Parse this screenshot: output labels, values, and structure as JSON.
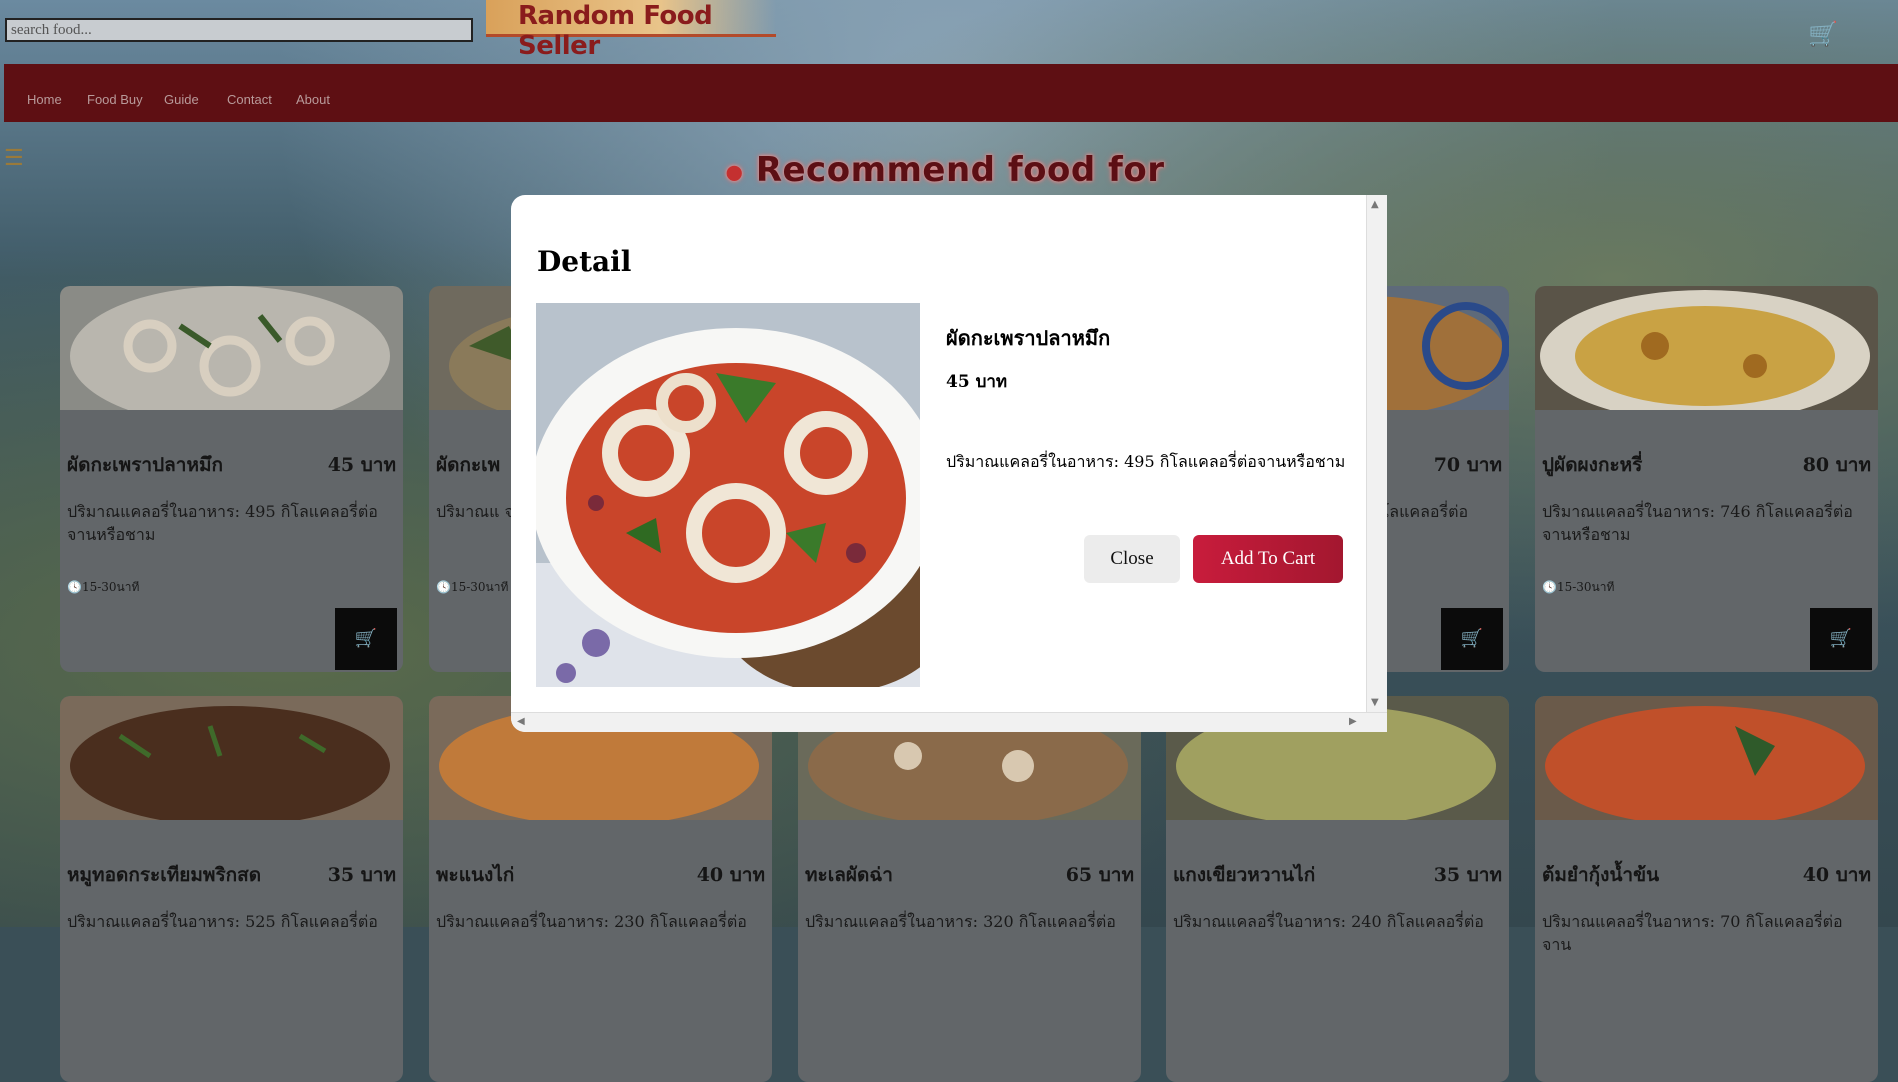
{
  "header": {
    "search_placeholder": "search food...",
    "logo_text": "Random Food Seller",
    "cart_icon": "shopping-cart-icon"
  },
  "nav": {
    "items": [
      "Home",
      "Food Buy",
      "Guide",
      "Contact",
      "About"
    ]
  },
  "section_title": "Recommend food for you",
  "cards_row1": [
    {
      "name": "ผัดกะเพราปลาหมึก",
      "price": "45 บาท",
      "desc": "ปริมาณแคลอรี่ในอาหาร: 495 กิโลแคลอรี่ต่อจานหรือชาม",
      "time": "15-30นาที"
    },
    {
      "name": "ผัดกะเพ",
      "price": "",
      "desc": "ปริมาณแ จานหรือชา",
      "time": "15-30นาที"
    },
    {
      "name": "",
      "price": "70 บาท",
      "desc": "กิโลแคลอรี่ต่อ",
      "time": ""
    },
    {
      "name": "ปูผัดผงกะหรี่",
      "price": "80 บาท",
      "desc": "ปริมาณแคลอรี่ในอาหาร: 746 กิโลแคลอรี่ต่อจานหรือชาม",
      "time": "15-30นาที"
    }
  ],
  "cards_row2": [
    {
      "name": "หมูทอดกระเทียมพริกสด",
      "price": "35 บาท",
      "desc": "ปริมาณแคลอรี่ในอาหาร: 525 กิโลแคลอรี่ต่อ"
    },
    {
      "name": "พะแนงไก่",
      "price": "40 บาท",
      "desc": "ปริมาณแคลอรี่ในอาหาร: 230 กิโลแคลอรี่ต่อ"
    },
    {
      "name": "ทะเลผัดฉ่า",
      "price": "65 บาท",
      "desc": "ปริมาณแคลอรี่ในอาหาร: 320 กิโลแคลอรี่ต่อ"
    },
    {
      "name": "แกงเขียวหวานไก่",
      "price": "35 บาท",
      "desc": "ปริมาณแคลอรี่ในอาหาร: 240 กิโลแคลอรี่ต่อ"
    },
    {
      "name": "ต้มยำกุ้งน้ำข้น",
      "price": "40 บาท",
      "desc": "ปริมาณแคลอรี่ในอาหาร: 70 กิโลแคลอรี่ต่อจาน"
    }
  ],
  "modal": {
    "title": "Detail",
    "food_name": "ผัดกะเพราปลาหมึก",
    "price": "45 บาท",
    "description": "ปริมาณแคลอรี่ในอาหาร: 495 กิโลแคลอรี่ต่อจานหรือชาม",
    "close_label": "Close",
    "add_label": "Add To Cart"
  },
  "colors": {
    "navbar": "#5e0f13",
    "add_button": "#c81c3c",
    "heading": "#5c0f14"
  }
}
